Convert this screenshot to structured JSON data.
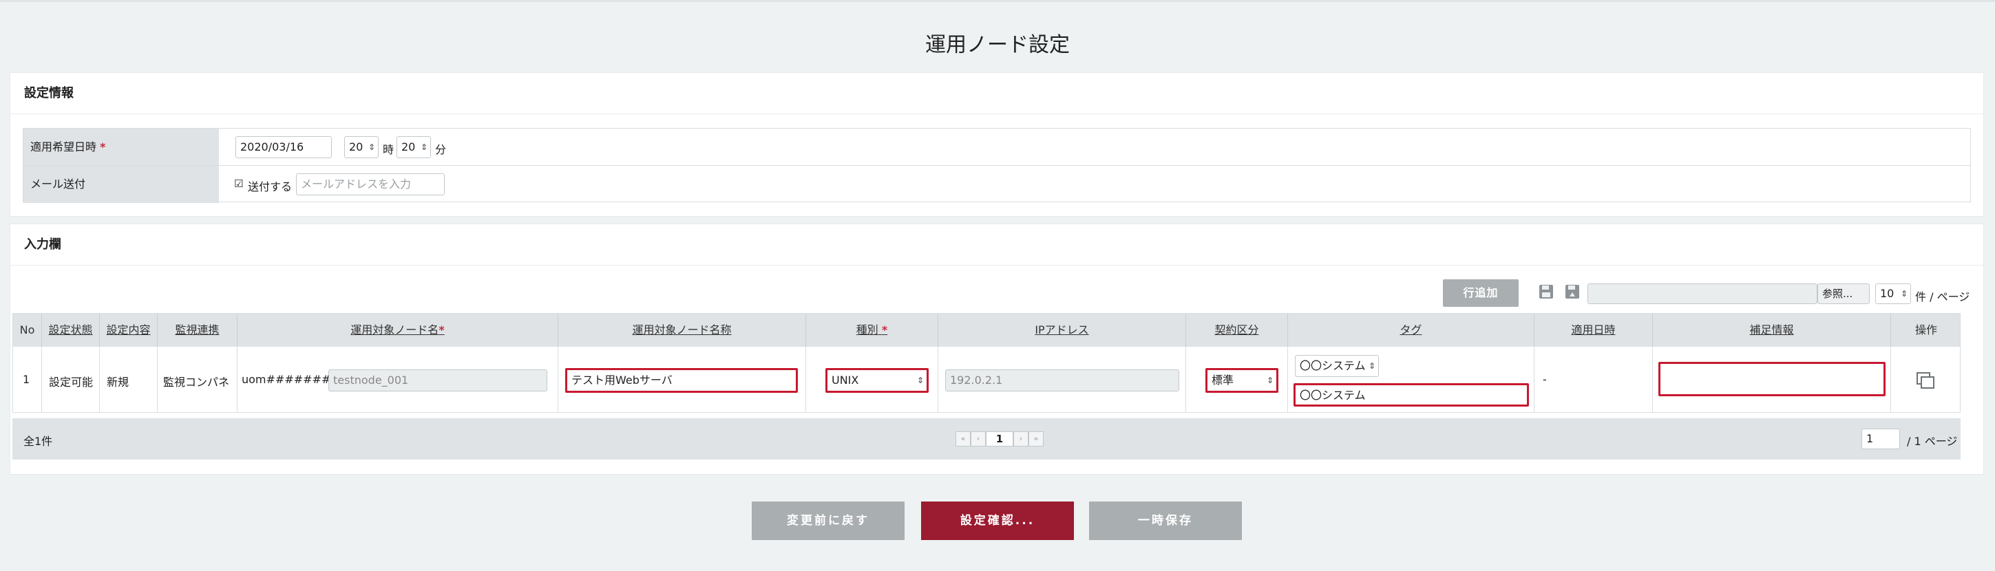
{
  "page": {
    "title": "運用ノード設定"
  },
  "settings": {
    "heading": "設定情報",
    "apply_label": "適用希望日時",
    "required_mark": "*",
    "date_value": "2020/03/16",
    "hour_value": "20",
    "hour_unit": "時",
    "minute_value": "20",
    "minute_unit": "分",
    "mail_label": "メール送付",
    "mail_check_label": "送付する",
    "mail_placeholder": "メールアドレスを入力"
  },
  "input_section": {
    "heading": "入力欄",
    "add_row_label": "行追加",
    "browse_label": "参照...",
    "per_page_value": "10",
    "per_page_suffix": "件 / ページ"
  },
  "table": {
    "headers": [
      "No",
      "設定状態",
      "設定内容",
      "監視連携",
      "運用対象ノード名",
      "運用対象ノード名称",
      "種別",
      "IPアドレス",
      "契約区分",
      "タグ",
      "適用日時",
      "補足情報",
      "操作"
    ],
    "row": {
      "no": "1",
      "status": "設定可能",
      "content": "新規",
      "monitor": "監視コンパネ",
      "node_prefix": "uom########_",
      "node_name": "testnode_001",
      "node_label": "テスト用Webサーバ",
      "kind": "UNIX",
      "ip": "192.0.2.1",
      "contract": "標準",
      "tag_select": "〇〇システム",
      "tag_input": "〇〇システム",
      "apply_date": "-",
      "note": ""
    }
  },
  "pager": {
    "total": "全1件",
    "current_page": "1",
    "page_input": "1",
    "page_suffix": "/  1 ページ",
    "first": "«",
    "prev": "‹",
    "next": "›",
    "last": "»"
  },
  "actions": {
    "revert": "変更前に戻す",
    "confirm": "設定確認...",
    "save": "一時保存"
  },
  "colors": {
    "accent": "#9b1b30",
    "header_bg": "#dfe3e6",
    "button_gray": "#a9aeb1",
    "highlight": "#c6192f"
  },
  "icons": {
    "save": "floppy-disk-icon",
    "load": "floppy-load-icon",
    "copy": "copy-icon"
  }
}
